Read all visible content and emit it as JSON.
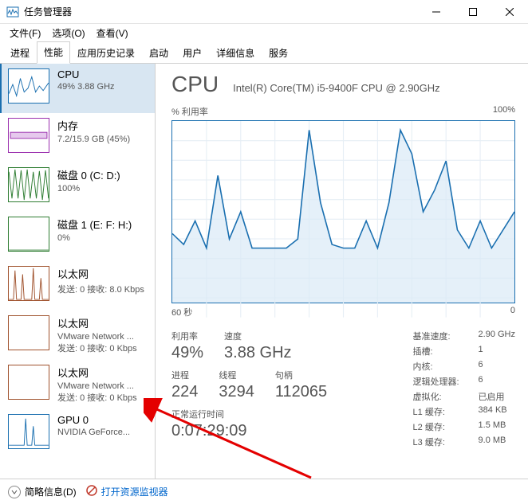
{
  "window": {
    "title": "任务管理器"
  },
  "menu": {
    "file": "文件(F)",
    "options": "选项(O)",
    "view": "查看(V)"
  },
  "tabs": [
    "进程",
    "性能",
    "应用历史记录",
    "启动",
    "用户",
    "详细信息",
    "服务"
  ],
  "active_tab": 1,
  "sidebar": [
    {
      "title": "CPU",
      "sub": "49% 3.88 GHz",
      "color": "#1a6fb0",
      "selected": true,
      "thumb": "cpu"
    },
    {
      "title": "内存",
      "sub": "7.2/15.9 GB (45%)",
      "color": "#9b2fae",
      "thumb": "mem"
    },
    {
      "title": "磁盘 0 (C: D:)",
      "sub": "100%",
      "color": "#2e7d32",
      "thumb": "disk0"
    },
    {
      "title": "磁盘 1 (E: F: H:)",
      "sub": "0%",
      "color": "#2e7d32",
      "thumb": "disk1"
    },
    {
      "title": "以太网",
      "sub": "发送: 0 接收: 8.0 Kbps",
      "color": "#a0522d",
      "thumb": "eth"
    },
    {
      "title": "以太网",
      "sub": "VMware Network ...",
      "sub2": "发送: 0 接收: 0 Kbps",
      "color": "#a0522d",
      "thumb": "eth2"
    },
    {
      "title": "以太网",
      "sub": "VMware Network ...",
      "sub2": "发送: 0 接收: 0 Kbps",
      "color": "#a0522d",
      "thumb": "eth3"
    },
    {
      "title": "GPU 0",
      "sub": "NVIDIA GeForce...",
      "color": "#1a6fb0",
      "thumb": "gpu"
    }
  ],
  "main": {
    "title": "CPU",
    "subtitle": "Intel(R) Core(TM) i5-9400F CPU @ 2.90GHz",
    "ylabel": "% 利用率",
    "ymax": "100%",
    "xlabel_left": "60 秒",
    "xlabel_right": "0"
  },
  "stats": {
    "util_label": "利用率",
    "util": "49%",
    "speed_label": "速度",
    "speed": "3.88 GHz",
    "proc_label": "进程",
    "proc": "224",
    "threads_label": "线程",
    "threads": "3294",
    "handles_label": "句柄",
    "handles": "112065",
    "uptime_label": "正常运行时间",
    "uptime": "0:07:29:09"
  },
  "right_stats": [
    {
      "k": "基准速度:",
      "v": "2.90 GHz"
    },
    {
      "k": "插槽:",
      "v": "1"
    },
    {
      "k": "内核:",
      "v": "6"
    },
    {
      "k": "逻辑处理器:",
      "v": "6"
    },
    {
      "k": "虚拟化:",
      "v": "已启用"
    },
    {
      "k": "L1 缓存:",
      "v": "384 KB"
    },
    {
      "k": "L2 缓存:",
      "v": "1.5 MB"
    },
    {
      "k": "L3 缓存:",
      "v": "9.0 MB"
    }
  ],
  "footer": {
    "fewer": "简略信息(D)",
    "resmon": "打开资源监视器"
  },
  "chart_data": {
    "type": "line",
    "title": "% 利用率",
    "xlabel": "60 秒 → 0",
    "ylabel": "%",
    "ylim": [
      0,
      100
    ],
    "x_seconds": [
      60,
      58,
      56,
      54,
      52,
      50,
      48,
      46,
      44,
      42,
      40,
      38,
      36,
      34,
      32,
      30,
      28,
      26,
      24,
      22,
      20,
      18,
      16,
      14,
      12,
      10,
      8,
      6,
      4,
      2,
      0
    ],
    "values": [
      38,
      32,
      45,
      30,
      70,
      35,
      50,
      30,
      30,
      30,
      30,
      35,
      95,
      55,
      32,
      30,
      30,
      45,
      30,
      55,
      95,
      82,
      50,
      62,
      78,
      40,
      30,
      45,
      30,
      40,
      50
    ]
  }
}
